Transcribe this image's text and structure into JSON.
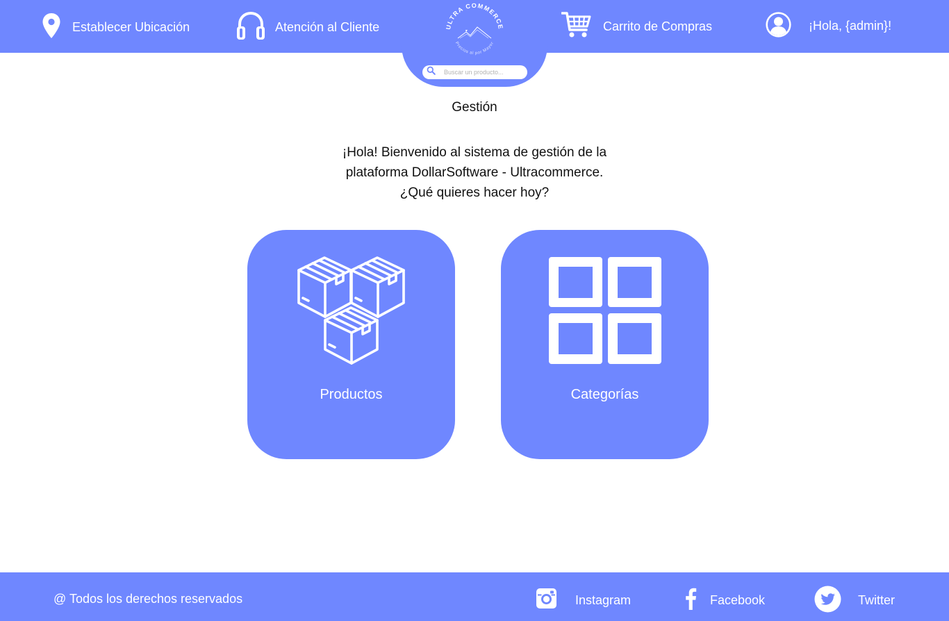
{
  "header": {
    "location_label": "Establecer Ubicación",
    "support_label": "Atención al Cliente",
    "cart_label": "Carrito de Compras",
    "greeting": "¡Hola, {admin}!",
    "logo": {
      "text_top": "ULTRA COMMERCE",
      "text_bottom": "Precios al por Mayor"
    },
    "search": {
      "placeholder": "Buscar un producto..."
    }
  },
  "main": {
    "title": "Gestión",
    "intro": "¡Hola! Bienvenido al sistema de gestión de la plataforma DollarSoftware - Ultracommerce. ¿Qué quieres hacer hoy?",
    "cards": [
      {
        "label": "Productos",
        "icon": "boxes-icon"
      },
      {
        "label": "Categorías",
        "icon": "grid-icon"
      }
    ]
  },
  "footer": {
    "copyright": "@ Todos los derechos reservados",
    "social": [
      {
        "label": "Instagram",
        "icon": "instagram-icon"
      },
      {
        "label": "Facebook",
        "icon": "facebook-icon"
      },
      {
        "label": "Twitter",
        "icon": "twitter-icon"
      }
    ]
  },
  "colors": {
    "accent": "#6f87ff",
    "background": "#ffffff",
    "text": "#111111"
  }
}
